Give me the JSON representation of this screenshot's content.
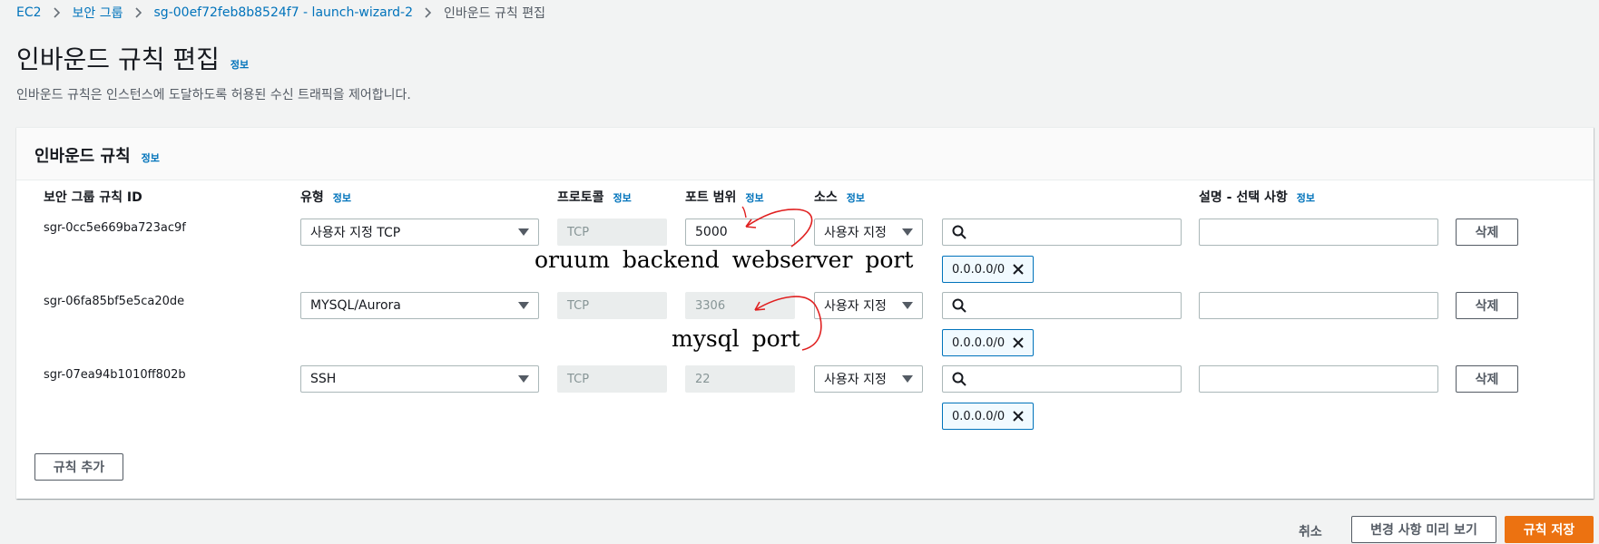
{
  "breadcrumb": [
    {
      "label": "EC2"
    },
    {
      "label": "보안 그룹"
    },
    {
      "label": "sg-00ef72feb8b8524f7 - launch-wizard-2"
    },
    {
      "label": "인바운드 규칙 편집"
    }
  ],
  "page": {
    "title": "인바운드 규칙 편집",
    "info_label": "정보",
    "description": "인바운드 규칙은 인스턴스에 도달하도록 허용된 수신 트래픽을 제어합니다."
  },
  "panel": {
    "title": "인바운드 규칙",
    "info_label": "정보",
    "columns": {
      "rule_id": "보안 그룹 규칙 ID",
      "type": "유형",
      "protocol": "프로토콜",
      "port_range": "포트 범위",
      "source": "소스",
      "description": "설명 - 선택 사항"
    },
    "rows": [
      {
        "rule_id": "sgr-0cc5e669ba723ac9f",
        "type": "사용자 지정 TCP",
        "protocol": "TCP",
        "port": "5000",
        "source": "사용자 지정",
        "cidr": "0.0.0.0/0",
        "delete_label": "삭제"
      },
      {
        "rule_id": "sgr-06fa85bf5e5ca20de",
        "type": "MYSQL/Aurora",
        "protocol": "TCP",
        "port": "3306",
        "source": "사용자 지정",
        "cidr": "0.0.0.0/0",
        "delete_label": "삭제"
      },
      {
        "rule_id": "sgr-07ea94b1010ff802b",
        "type": "SSH",
        "protocol": "TCP",
        "port": "22",
        "source": "사용자 지정",
        "cidr": "0.0.0.0/0",
        "delete_label": "삭제"
      }
    ],
    "add_rule_label": "규칙 추가"
  },
  "annotations": {
    "backend": "oruum backend webserver port",
    "mysql": "mysql port"
  },
  "footer": {
    "cancel_label": "취소",
    "preview_label": "변경 사항 미리 보기",
    "save_label": "규칙 저장"
  },
  "colors": {
    "link": "#0073bb",
    "primary": "#ec7211",
    "annotation": "#e02020"
  }
}
